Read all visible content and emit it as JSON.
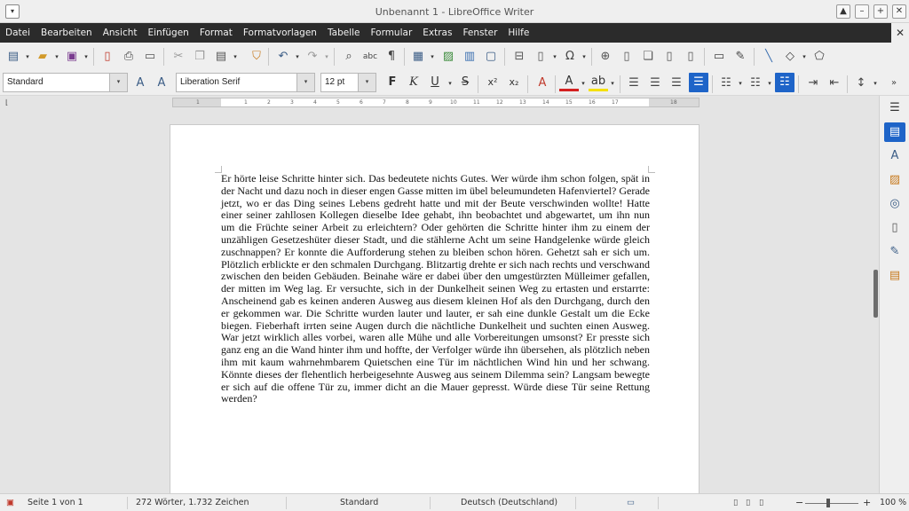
{
  "window": {
    "title": "Unbenannt 1 - LibreOffice Writer",
    "menu_icon": "window-menu-icon",
    "controls": [
      "▲",
      "–",
      "+",
      "✕"
    ]
  },
  "menubar": {
    "items": [
      "Datei",
      "Bearbeiten",
      "Ansicht",
      "Einfügen",
      "Format",
      "Formatvorlagen",
      "Tabelle",
      "Formular",
      "Extras",
      "Fenster",
      "Hilfe"
    ],
    "close": "✕"
  },
  "formatting": {
    "paragraph_style": "Standard",
    "font_name": "Liberation Serif",
    "font_size": "12 pt",
    "bold": "F",
    "italic": "K",
    "underline": "U",
    "strikethrough": "S",
    "superscript": "x²",
    "subscript": "x₂"
  },
  "ruler": {
    "numbers": [
      "1",
      "1",
      "2",
      "3",
      "4",
      "5",
      "6",
      "7",
      "8",
      "9",
      "10",
      "11",
      "12",
      "13",
      "14",
      "15",
      "16",
      "17",
      "18"
    ]
  },
  "document": {
    "text": "Er hörte leise Schritte hinter sich. Das bedeutete nichts Gutes. Wer würde ihm schon folgen, spät in der Nacht und dazu noch in dieser engen Gasse mitten im übel beleumundeten Hafenviertel? Gerade jetzt, wo er das Ding seines Lebens gedreht hatte und mit der Beute verschwinden wollte! Hatte einer seiner zahllosen Kollegen dieselbe Idee gehabt, ihn beobachtet und abgewartet, um ihn nun um die Früchte seiner Arbeit zu erleichtern? Oder gehörten die Schritte hinter ihm zu einem der unzähligen Gesetzeshüter dieser Stadt, und die stählerne Acht um seine Handgelenke würde gleich zuschnappen? Er konnte die Aufforderung stehen zu bleiben schon hören. Gehetzt sah er sich um. Plötzlich erblickte er den schmalen Durchgang. Blitzartig drehte er sich nach rechts und verschwand zwischen den beiden Gebäuden. Beinahe wäre er dabei über den umgestürzten Mülleimer gefallen, der mitten im Weg lag. Er versuchte, sich in der Dunkelheit seinen Weg zu ertasten und erstarrte: Anscheinend gab es keinen anderen Ausweg aus diesem kleinen Hof als den Durchgang, durch den er gekommen war. Die Schritte wurden lauter und lauter, er sah eine dunkle Gestalt um die Ecke biegen. Fieberhaft irrten seine Augen durch die nächtliche Dunkelheit und suchten einen Ausweg. War jetzt wirklich alles vorbei, waren alle Mühe und alle Vorbereitungen umsonst? Er presste sich ganz eng an die Wand hinter ihm und hoffte, der Verfolger würde ihn übersehen, als plötzlich neben ihm mit kaum wahrnehmbarem Quietschen eine Tür im nächtlichen Wind hin und her schwang. Könnte dieses der flehentlich herbeigesehnte Ausweg aus seinem Dilemma sein? Langsam bewegte er sich auf die offene Tür zu, immer dicht an die Mauer gepresst. Würde diese Tür seine Rettung werden?"
  },
  "statusbar": {
    "page": "Seite 1 von 1",
    "words": "272 Wörter, 1.732 Zeichen",
    "style": "Standard",
    "language": "Deutsch (Deutschland)",
    "zoom_minus": "−",
    "zoom_plus": "+",
    "zoom": "100 %"
  },
  "colors": {
    "accent": "#1e64c8",
    "menubar": "#2b2b2b",
    "font_color": "#d42020",
    "highlight": "#f5e000"
  }
}
